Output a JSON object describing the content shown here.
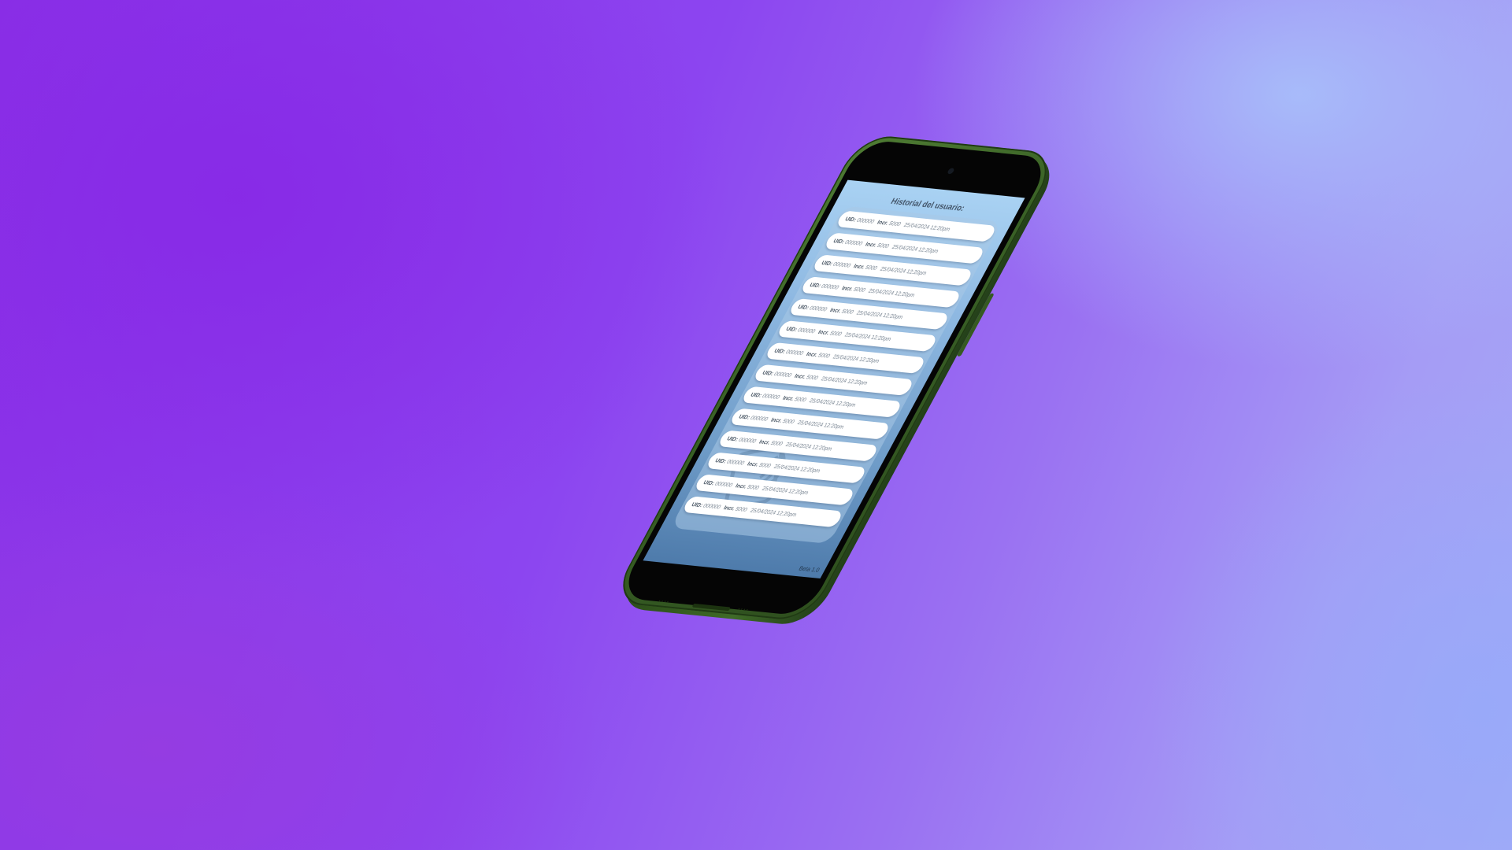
{
  "screen": {
    "title": "Historial del usuario:",
    "version": "Beta 1.0"
  },
  "history": [
    {
      "uid_label": "UID:",
      "uid": "000000",
      "incr_label": "Incr.",
      "incr": "5000",
      "datetime": "25/04/2024 12:20pm"
    },
    {
      "uid_label": "UID:",
      "uid": "000000",
      "incr_label": "Incr.",
      "incr": "5000",
      "datetime": "25/04/2024 12:20pm"
    },
    {
      "uid_label": "UID:",
      "uid": "000000",
      "incr_label": "Incr.",
      "incr": "5000",
      "datetime": "25/04/2024 12:20pm"
    },
    {
      "uid_label": "UID:",
      "uid": "000000",
      "incr_label": "Incr.",
      "incr": "5000",
      "datetime": "25/04/2024 12:20pm"
    },
    {
      "uid_label": "UID:",
      "uid": "000000",
      "incr_label": "Incr.",
      "incr": "5000",
      "datetime": "25/04/2024 12:20pm"
    },
    {
      "uid_label": "UID:",
      "uid": "000000",
      "incr_label": "Incr.",
      "incr": "5000",
      "datetime": "25/04/2024 12:20pm"
    },
    {
      "uid_label": "UID:",
      "uid": "000000",
      "incr_label": "Incr.",
      "incr": "5000",
      "datetime": "25/04/2024 12:20pm"
    },
    {
      "uid_label": "UID:",
      "uid": "000000",
      "incr_label": "Incr.",
      "incr": "5000",
      "datetime": "25/04/2024 12:20pm"
    },
    {
      "uid_label": "UID:",
      "uid": "000000",
      "incr_label": "Incr.",
      "incr": "5000",
      "datetime": "25/04/2024 12:20pm"
    },
    {
      "uid_label": "UID:",
      "uid": "000000",
      "incr_label": "Incr.",
      "incr": "5000",
      "datetime": "25/04/2024 12:20pm"
    },
    {
      "uid_label": "UID:",
      "uid": "000000",
      "incr_label": "Incr.",
      "incr": "5000",
      "datetime": "25/04/2024 12:20pm"
    },
    {
      "uid_label": "UID:",
      "uid": "000000",
      "incr_label": "Incr.",
      "incr": "5000",
      "datetime": "25/04/2024 12:20pm"
    },
    {
      "uid_label": "UID:",
      "uid": "000000",
      "incr_label": "Incr.",
      "incr": "5000",
      "datetime": "25/04/2024 12:20pm"
    },
    {
      "uid_label": "UID:",
      "uid": "000000",
      "incr_label": "Incr.",
      "incr": "5000",
      "datetime": "25/04/2024 12:20pm"
    }
  ],
  "icons": {
    "watermark": "nfc-card-icon",
    "camera": "front-camera-icon"
  },
  "colors": {
    "phone_frame": "#3a6226",
    "screen_top": "#a9d2f3",
    "screen_bottom": "#4e7bab",
    "background_left": "#8a2fe6",
    "background_right": "#a4aaf6"
  }
}
